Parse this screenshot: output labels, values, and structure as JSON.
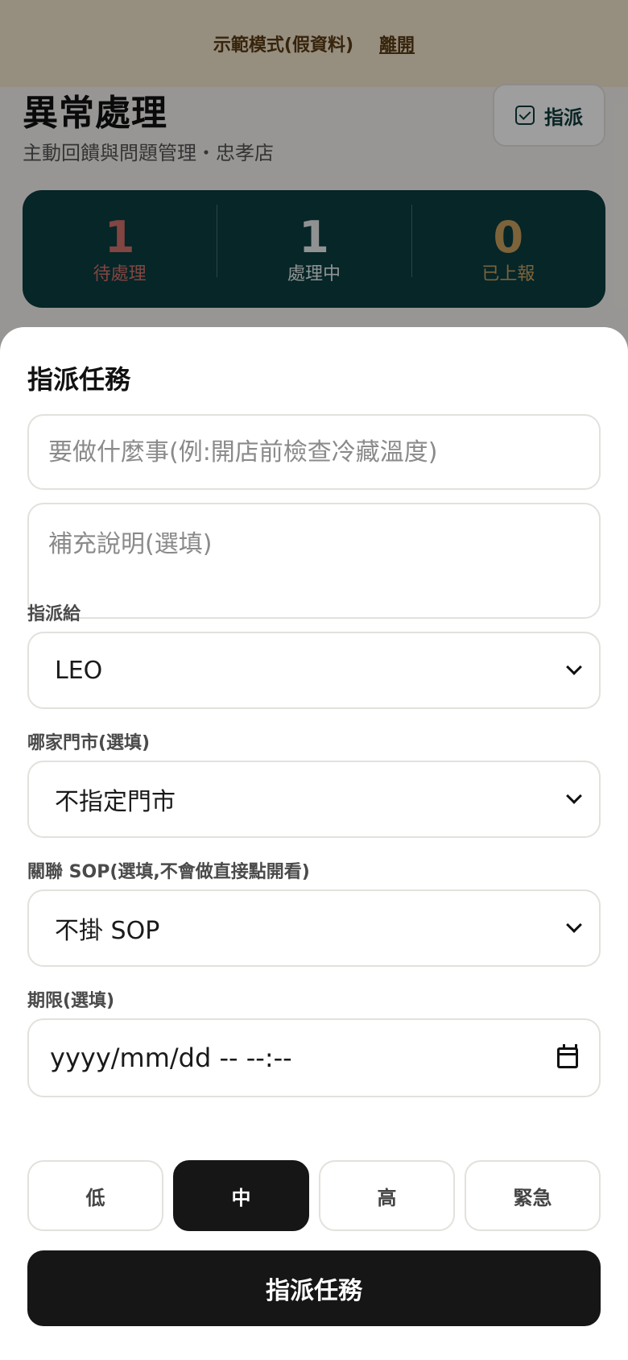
{
  "banner": {
    "text": "示範模式(假資料)",
    "leave_label": "離開"
  },
  "page": {
    "title": "異常處理",
    "subtitle": "主動回饋與問題管理・忠孝店",
    "assign_label": "指派"
  },
  "stats": [
    {
      "value": "1",
      "label": "待處理",
      "color": "#d2706a"
    },
    {
      "value": "1",
      "label": "處理中",
      "color": "#e8ecec"
    },
    {
      "value": "0",
      "label": "已上報",
      "color": "#c9a15e"
    }
  ],
  "modal": {
    "title": "指派任務",
    "task_placeholder": "要做什麼事(例:開店前檢查冷藏溫度)",
    "note_placeholder": "補充說明(選填)",
    "assignee_label": "指派給",
    "assignee_value": "LEO",
    "store_label": "哪家門市(選填)",
    "store_value": "不指定門市",
    "sop_label": "關聯 SOP(選填,不會做直接點開看)",
    "sop_value": "不掛 SOP",
    "deadline_label": "期限(選填)",
    "deadline_value": "yyyy/mm/dd -- --:--",
    "priorities": [
      "低",
      "中",
      "高",
      "緊急"
    ],
    "selected_priority": "中",
    "submit_label": "指派任務"
  }
}
